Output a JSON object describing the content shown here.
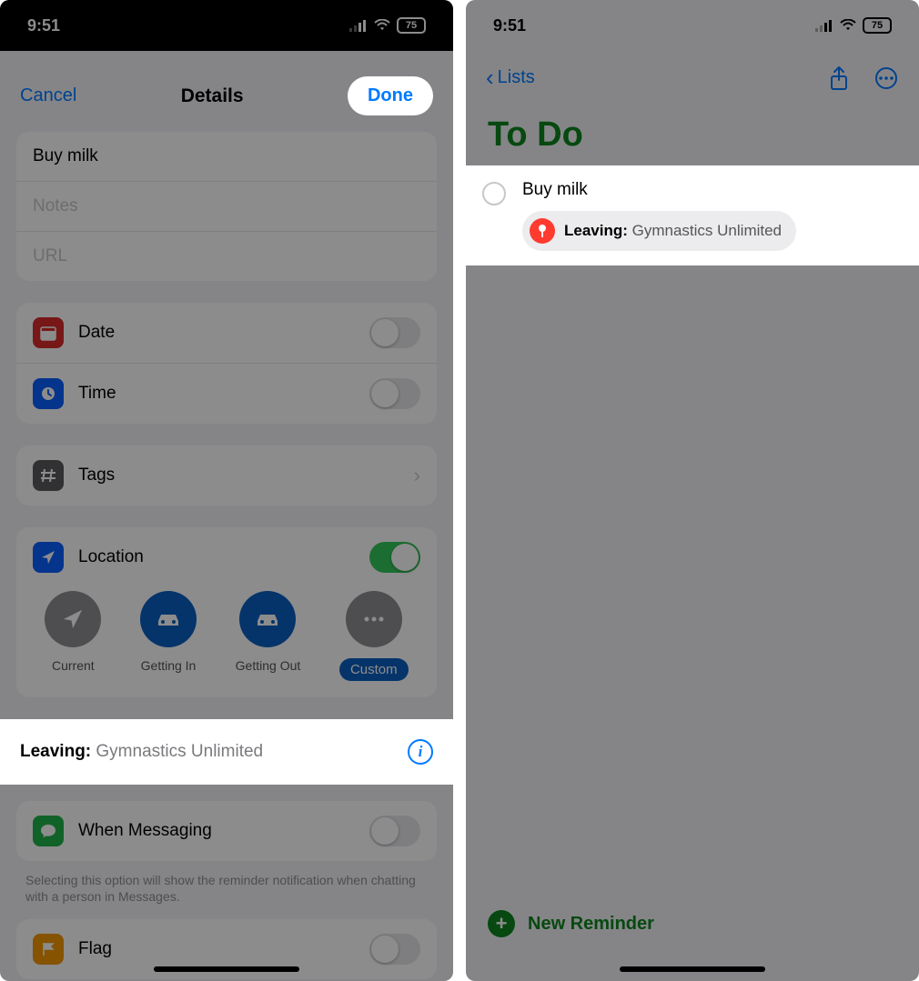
{
  "status": {
    "time": "9:51",
    "battery": "75"
  },
  "left": {
    "nav": {
      "cancel": "Cancel",
      "title": "Details",
      "done": "Done"
    },
    "fields": {
      "title_value": "Buy milk",
      "notes_placeholder": "Notes",
      "url_placeholder": "URL"
    },
    "rows": {
      "date": "Date",
      "time": "Time",
      "tags": "Tags",
      "location": "Location",
      "messaging": "When Messaging",
      "flag": "Flag"
    },
    "location_options": {
      "current": "Current",
      "getting_in": "Getting In",
      "getting_out": "Getting Out",
      "custom": "Custom"
    },
    "leaving": {
      "label": "Leaving:",
      "place": "Gymnastics Unlimited"
    },
    "messaging_footer": "Selecting this option will show the reminder notification when chatting with a person in Messages."
  },
  "right": {
    "back": "Lists",
    "list_title": "To Do",
    "reminder": {
      "title": "Buy milk",
      "badge_label": "Leaving:",
      "badge_place": "Gymnastics Unlimited"
    },
    "new_reminder": "New Reminder"
  }
}
